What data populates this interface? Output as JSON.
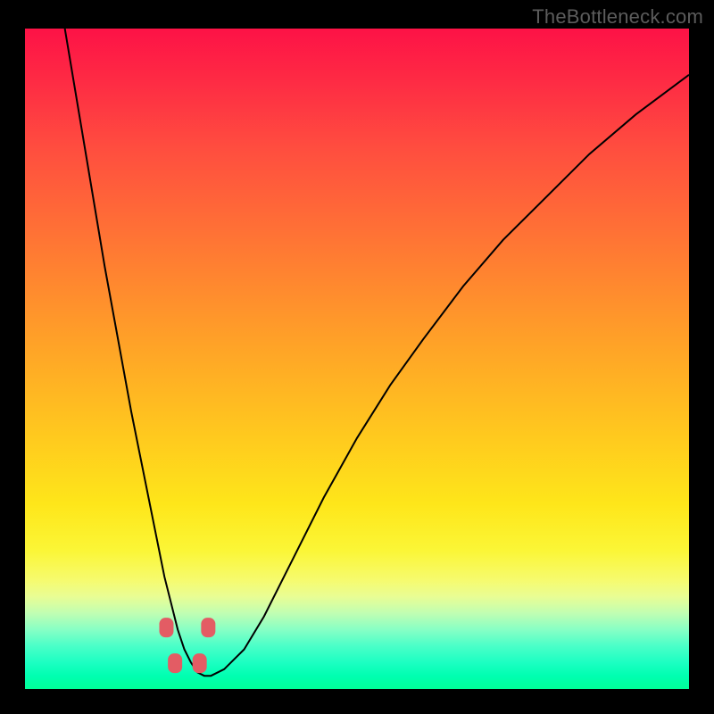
{
  "watermark": "TheBottleneck.com",
  "chart_data": {
    "type": "line",
    "title": "",
    "xlabel": "",
    "ylabel": "",
    "xlim": [
      0,
      100
    ],
    "ylim": [
      0,
      100
    ],
    "series": [
      {
        "name": "bottleneck-curve",
        "x": [
          6,
          8,
          10,
          12,
          14,
          16,
          18,
          20,
          21,
          22,
          23,
          24,
          25,
          26,
          27,
          28,
          30,
          33,
          36,
          40,
          45,
          50,
          55,
          60,
          66,
          72,
          78,
          85,
          92,
          100
        ],
        "values": [
          100,
          88,
          76,
          64,
          53,
          42,
          32,
          22,
          17,
          13,
          9,
          6,
          4,
          2.5,
          2,
          2,
          3,
          6,
          11,
          19,
          29,
          38,
          46,
          53,
          61,
          68,
          74,
          81,
          87,
          93
        ]
      }
    ],
    "markers": [
      {
        "x": 21.3,
        "y": 9.3
      },
      {
        "x": 27.6,
        "y": 9.3
      },
      {
        "x": 22.6,
        "y": 3.9
      },
      {
        "x": 26.3,
        "y": 3.9
      }
    ],
    "gradient_stops": [
      {
        "pos": 0,
        "color": "#fd1246"
      },
      {
        "pos": 0.18,
        "color": "#ff4d3f"
      },
      {
        "pos": 0.48,
        "color": "#ffa327"
      },
      {
        "pos": 0.72,
        "color": "#fee61a"
      },
      {
        "pos": 0.86,
        "color": "#e9fd94"
      },
      {
        "pos": 0.93,
        "color": "#4affc8"
      },
      {
        "pos": 1.0,
        "color": "#00ff98"
      }
    ]
  }
}
